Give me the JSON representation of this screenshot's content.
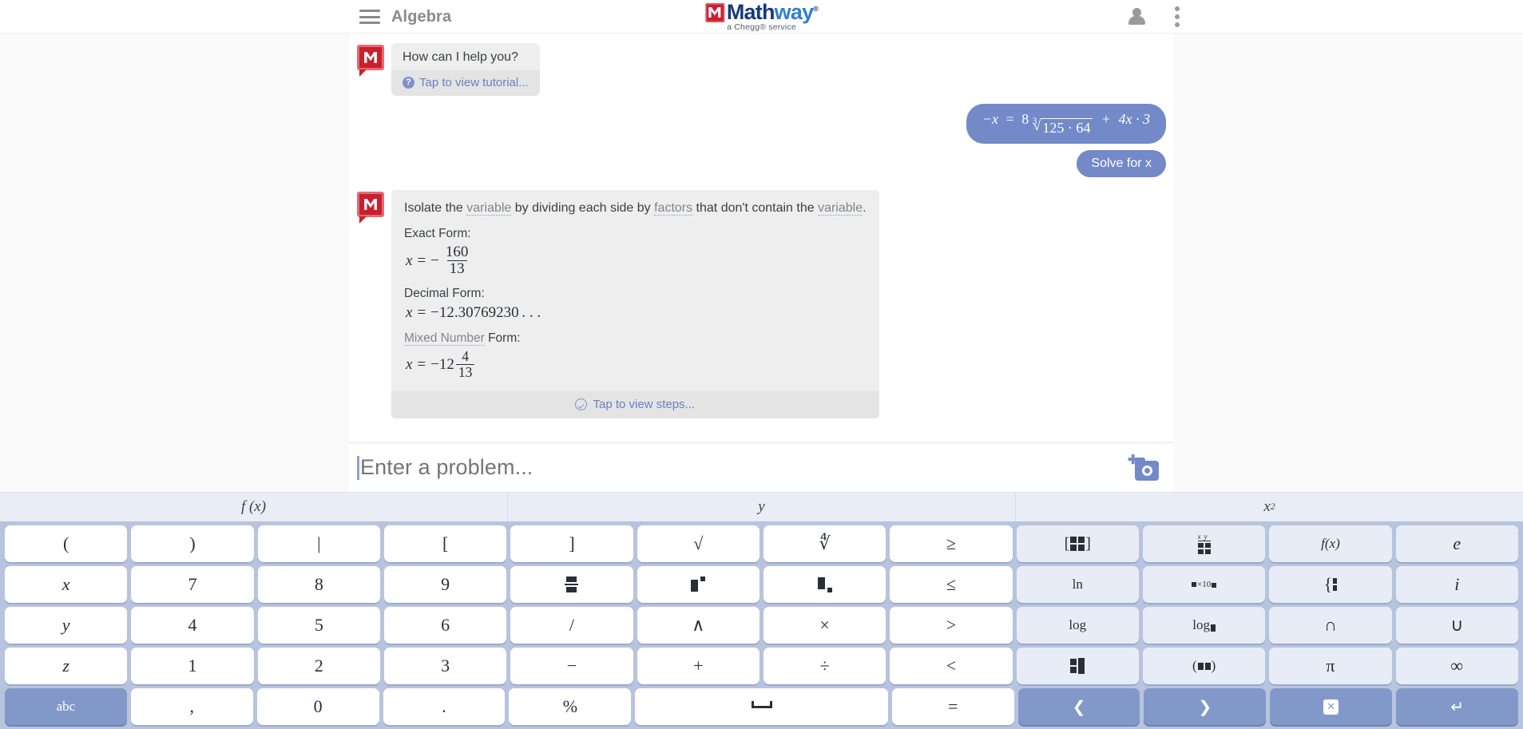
{
  "header": {
    "menu_icon": "hamburger-icon",
    "subject": "Algebra",
    "logo": {
      "mark": "M",
      "text_dark": "Math",
      "text_light": "way",
      "trademark": "®",
      "subtitle": "a Chegg® service"
    },
    "account_icon": "person-icon",
    "overflow_icon": "kebab-menu-icon"
  },
  "chat": {
    "greeting": {
      "text": "How can I help you?",
      "tutorial_link": "Tap to view tutorial...",
      "help_icon": "question-mark-icon"
    },
    "user_equation": {
      "lhs": "−x",
      "equals": "=",
      "coefficient": "8",
      "root_index": "3",
      "radicand": "125 · 64",
      "plus": "+",
      "tail": "4x · 3",
      "plain": "−x = 8∛(125·64) + 4x·3"
    },
    "user_command": "Solve for x",
    "answer": {
      "intro_parts": [
        {
          "text": "Isolate the ",
          "dotted": false
        },
        {
          "text": "variable",
          "dotted": true
        },
        {
          "text": " by dividing each side by ",
          "dotted": false
        },
        {
          "text": "factors",
          "dotted": true
        },
        {
          "text": " that don't contain the ",
          "dotted": false
        },
        {
          "text": "variable",
          "dotted": true
        },
        {
          "text": ".",
          "dotted": false
        }
      ],
      "exact_label": "Exact Form:",
      "exact": {
        "lhs": "x",
        "eq": "=",
        "sign": "−",
        "numerator": "160",
        "denominator": "13"
      },
      "decimal_label": "Decimal Form:",
      "decimal": {
        "lhs": "x",
        "eq": "=",
        "value": "−12.30769230 . . ."
      },
      "mixed_label_dotted": "Mixed Number",
      "mixed_label_rest": " Form:",
      "mixed": {
        "lhs": "x",
        "eq": "=",
        "whole": "−12",
        "numerator": "4",
        "denominator": "13"
      },
      "steps_link": "Tap to view steps...",
      "steps_icon": "check-circle-icon"
    }
  },
  "input": {
    "placeholder": "Enter a problem...",
    "value": "",
    "camera_icon": "camera-icon"
  },
  "tabs": [
    {
      "name": "tab-fx",
      "label": "f (x)"
    },
    {
      "name": "tab-y",
      "label": "y"
    },
    {
      "name": "tab-x2",
      "label": "x",
      "sup": "2"
    }
  ],
  "keypad": {
    "rows": [
      [
        {
          "name": "key-open-paren",
          "label": "(",
          "style": "plain"
        },
        {
          "name": "key-close-paren",
          "label": ")",
          "style": "plain"
        },
        {
          "name": "key-abs-bar",
          "label": "|",
          "style": "plain"
        },
        {
          "name": "key-open-bracket",
          "label": "[",
          "style": "plain"
        },
        {
          "name": "key-close-bracket",
          "label": "]",
          "style": "plain"
        },
        {
          "name": "key-square-root",
          "label": "√",
          "style": "plain"
        },
        {
          "name": "key-nth-root",
          "label": "∜",
          "style": "plain"
        },
        {
          "name": "key-greater-equal",
          "label": "≥",
          "style": "plain"
        },
        {
          "name": "key-matrix",
          "label": "",
          "style": "fn",
          "glyph": "matrix-icon"
        },
        {
          "name": "key-table",
          "label": "",
          "style": "fn",
          "glyph": "table-icon"
        },
        {
          "name": "key-function",
          "label": "f(x)",
          "style": "fn"
        },
        {
          "name": "key-euler-e",
          "label": "e",
          "style": "fn"
        }
      ],
      [
        {
          "name": "key-x",
          "label": "x",
          "style": "plain"
        },
        {
          "name": "key-7",
          "label": "7",
          "style": "plain"
        },
        {
          "name": "key-8",
          "label": "8",
          "style": "plain"
        },
        {
          "name": "key-9",
          "label": "9",
          "style": "plain"
        },
        {
          "name": "key-fraction",
          "label": "",
          "style": "plain",
          "glyph": "fraction-icon"
        },
        {
          "name": "key-superscript",
          "label": "",
          "style": "plain",
          "glyph": "superscript-icon"
        },
        {
          "name": "key-subscript",
          "label": "",
          "style": "plain",
          "glyph": "subscript-icon"
        },
        {
          "name": "key-less-equal",
          "label": "≤",
          "style": "plain"
        },
        {
          "name": "key-natural-log",
          "label": "ln",
          "style": "fn"
        },
        {
          "name": "key-scientific-notation",
          "label": "",
          "style": "fn",
          "glyph": "sci-notation-icon"
        },
        {
          "name": "key-piecewise",
          "label": "",
          "style": "fn",
          "glyph": "piecewise-icon"
        },
        {
          "name": "key-imaginary-i",
          "label": "i",
          "style": "fn"
        }
      ],
      [
        {
          "name": "key-y",
          "label": "y",
          "style": "plain"
        },
        {
          "name": "key-4",
          "label": "4",
          "style": "plain"
        },
        {
          "name": "key-5",
          "label": "5",
          "style": "plain"
        },
        {
          "name": "key-6",
          "label": "6",
          "style": "plain"
        },
        {
          "name": "key-divide-slash",
          "label": "/",
          "style": "plain"
        },
        {
          "name": "key-caret-power",
          "label": "∧",
          "style": "plain"
        },
        {
          "name": "key-multiply",
          "label": "×",
          "style": "plain"
        },
        {
          "name": "key-greater-than",
          "label": ">",
          "style": "plain"
        },
        {
          "name": "key-log",
          "label": "log",
          "style": "fn"
        },
        {
          "name": "key-log-base",
          "label": "",
          "style": "fn",
          "glyph": "log-base-icon"
        },
        {
          "name": "key-intersection",
          "label": "∩",
          "style": "fn"
        },
        {
          "name": "key-union",
          "label": "∪",
          "style": "fn"
        }
      ],
      [
        {
          "name": "key-z",
          "label": "z",
          "style": "plain"
        },
        {
          "name": "key-1",
          "label": "1",
          "style": "plain"
        },
        {
          "name": "key-2",
          "label": "2",
          "style": "plain"
        },
        {
          "name": "key-3",
          "label": "3",
          "style": "plain"
        },
        {
          "name": "key-minus",
          "label": "−",
          "style": "plain"
        },
        {
          "name": "key-plus",
          "label": "+",
          "style": "plain"
        },
        {
          "name": "key-divide",
          "label": "÷",
          "style": "plain"
        },
        {
          "name": "key-less-than",
          "label": "<",
          "style": "plain"
        },
        {
          "name": "key-matrix-2",
          "label": "",
          "style": "fn",
          "glyph": "matrix2-icon"
        },
        {
          "name": "key-interval",
          "label": "",
          "style": "fn",
          "glyph": "interval-icon"
        },
        {
          "name": "key-pi",
          "label": "π",
          "style": "fn"
        },
        {
          "name": "key-infinity",
          "label": "∞",
          "style": "fn"
        }
      ],
      [
        {
          "name": "key-abc",
          "label": "abc",
          "style": "accent"
        },
        {
          "name": "key-comma",
          "label": ",",
          "style": "plain"
        },
        {
          "name": "key-0",
          "label": "0",
          "style": "plain"
        },
        {
          "name": "key-period",
          "label": ".",
          "style": "plain"
        },
        {
          "name": "key-percent",
          "label": "%",
          "style": "plain"
        },
        {
          "name": "key-space",
          "label": "",
          "style": "wide",
          "glyph": "space-icon"
        },
        {
          "name": "key-equals",
          "label": "=",
          "style": "plain"
        },
        {
          "name": "key-cursor-left",
          "label": "❮",
          "style": "accent"
        },
        {
          "name": "key-cursor-right",
          "label": "❯",
          "style": "accent"
        },
        {
          "name": "key-backspace",
          "label": "",
          "style": "accent",
          "glyph": "backspace-icon"
        },
        {
          "name": "key-enter",
          "label": "↵",
          "style": "accent"
        }
      ]
    ]
  },
  "colors": {
    "brand_red": "#c8202e",
    "logo_dark_blue": "#16397e",
    "logo_light_blue": "#2f7fd4",
    "bubble_blue": "#7389c8",
    "keypad_bg": "#b8c4de",
    "key_fn_bg": "#e7ecf6",
    "accent_key": "#8298c9",
    "link_blue": "#6b7fc2"
  }
}
